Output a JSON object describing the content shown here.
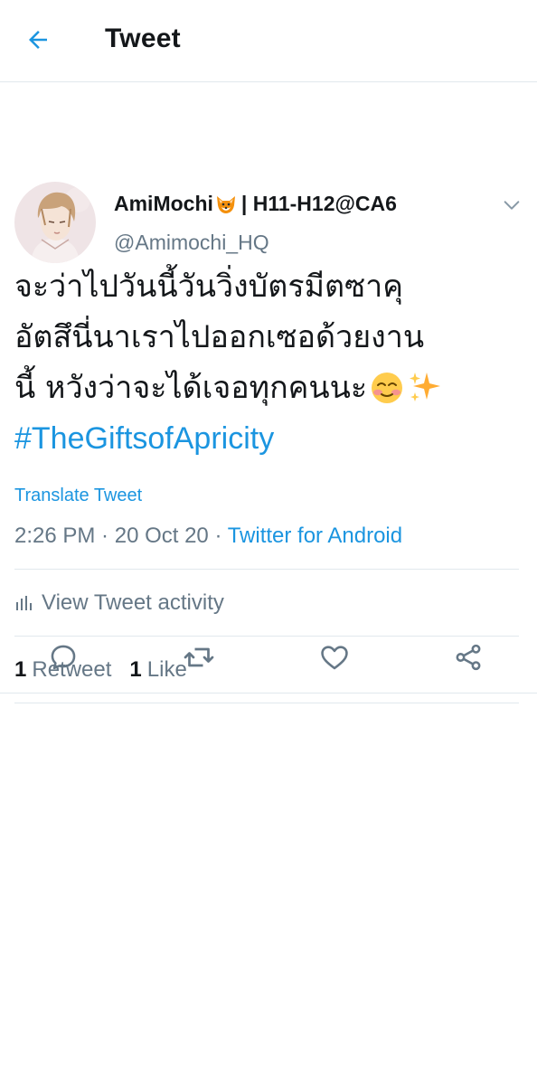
{
  "header": {
    "title": "Tweet"
  },
  "tweet": {
    "author": {
      "name": "AmiMochi",
      "name_suffix": "| H11-H12@CA6",
      "name_emoji": "fox-face-icon",
      "handle": "@Amimochi_HQ"
    },
    "text_lines": [
      "จะว่าไปวันนี้วันวิ่งบัตรมีตซาคุ",
      "อัตสึนี่นาเราไปออกเซอด้วยงาน",
      "นี้ หวังว่าจะได้เจอทุกคนนะ"
    ],
    "text_emojis": [
      "smiling-face-icon",
      "sparkles-icon"
    ],
    "hashtag": "#TheGiftsofApricity",
    "translate_label": "Translate Tweet",
    "time": "2:26 PM",
    "date": "20 Oct 20",
    "source": "Twitter for Android",
    "separator": " · ",
    "activity_label": "View Tweet activity",
    "stats": {
      "retweets_count": "1",
      "retweets_label": "Retweet",
      "likes_count": "1",
      "likes_label": "Like"
    }
  },
  "colors": {
    "accent": "#1b95e0",
    "secondary_text": "#657786",
    "primary_text": "#14171a",
    "divider": "#e1e8ed"
  }
}
